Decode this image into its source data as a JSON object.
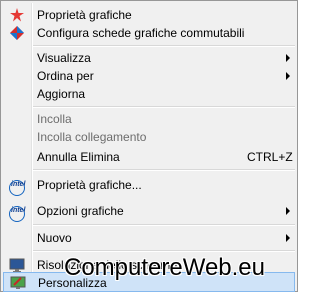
{
  "menu": {
    "items": [
      {
        "label": "Proprietà grafiche",
        "icon": "red-star-icon"
      },
      {
        "label": "Configura schede grafiche commutabili",
        "icon": "diamond-graphics-icon"
      },
      {
        "label": "Visualizza",
        "submenu": true
      },
      {
        "label": "Ordina per",
        "submenu": true
      },
      {
        "label": "Aggiorna"
      },
      {
        "label": "Incolla",
        "disabled": true
      },
      {
        "label": "Incolla collegamento",
        "disabled": true
      },
      {
        "label": "Annulla Elimina",
        "shortcut": "CTRL+Z"
      },
      {
        "label": "Proprietà grafiche...",
        "icon": "intel-icon"
      },
      {
        "label": "Opzioni grafiche",
        "icon": "intel-icon",
        "submenu": true
      },
      {
        "label": "Nuovo",
        "submenu": true
      },
      {
        "label": "Risoluzione dello schermo",
        "icon": "monitor-icon"
      },
      {
        "label": "Personalizza",
        "icon": "personalize-icon"
      }
    ]
  },
  "intel_logo_text": "intel",
  "watermark": "ComputereWeb.eu"
}
